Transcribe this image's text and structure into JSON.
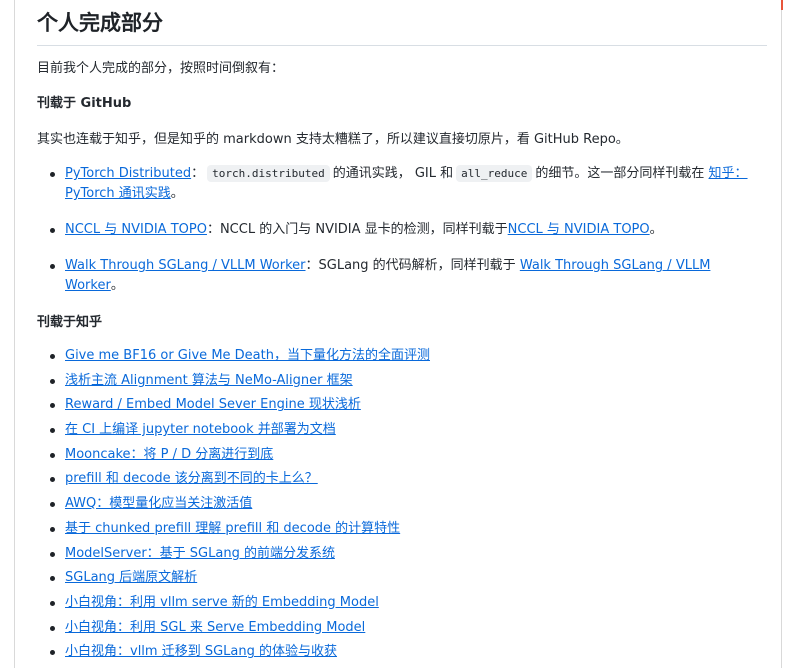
{
  "heading": "个人完成部分",
  "intro": "目前我个人完成的部分，按照时间倒叙有：",
  "github_section": {
    "title": "刊载于 GitHub",
    "description": "其实也连载于知乎，但是知乎的 markdown 支持太糟糕了，所以建议直接切原片，看 GitHub Repo。",
    "items": [
      {
        "link": "PyTorch Distributed",
        "t1": "：",
        "code1": "torch.distributed",
        "t2": "的通讯实践， GIL 和",
        "code2": "all_reduce",
        "t3": "的细节。这一部分同样刊载在",
        "link2": "知乎：PyTorch 通讯实践",
        "t4": "。"
      },
      {
        "link": "NCCL 与 NVIDIA TOPO",
        "t1": "：NCCL 的入门与 NVIDIA 显卡的检测，同样刊载于",
        "link2": "NCCL 与 NVIDIA TOPO",
        "t2": "。"
      },
      {
        "link": "Walk Through SGLang / VLLM Worker",
        "t1": "：SGLang 的代码解析，同样刊载于",
        "link2": "Walk Through SGLang / VLLM Worker",
        "t2": "。"
      }
    ]
  },
  "zhihu_section": {
    "title": "刊载于知乎",
    "items": [
      "Give me BF16 or Give Me Death，当下量化方法的全面评测",
      "浅析主流 Alignment 算法与 NeMo-Aligner 框架",
      "Reward / Embed Model Sever Engine 现状浅析",
      "在 CI 上编译 jupyter notebook 并部署为文档",
      "Mooncake：将 P / D 分离进行到底",
      "prefill 和 decode 该分离到不同的卡上么？",
      "AWQ：模型量化应当关注激活值",
      "基于 chunked prefill 理解 prefill 和 decode 的计算特性",
      "ModelServer：基于 SGLang 的前端分发系统",
      "SGLang 后端原文解析",
      "小白视角：利用 vllm serve 新的 Embedding Model",
      "小白视角：利用 SGL 来 Serve Embedding Model",
      "小白视角：vllm 迁移到 SGLang 的体验与收获"
    ]
  }
}
